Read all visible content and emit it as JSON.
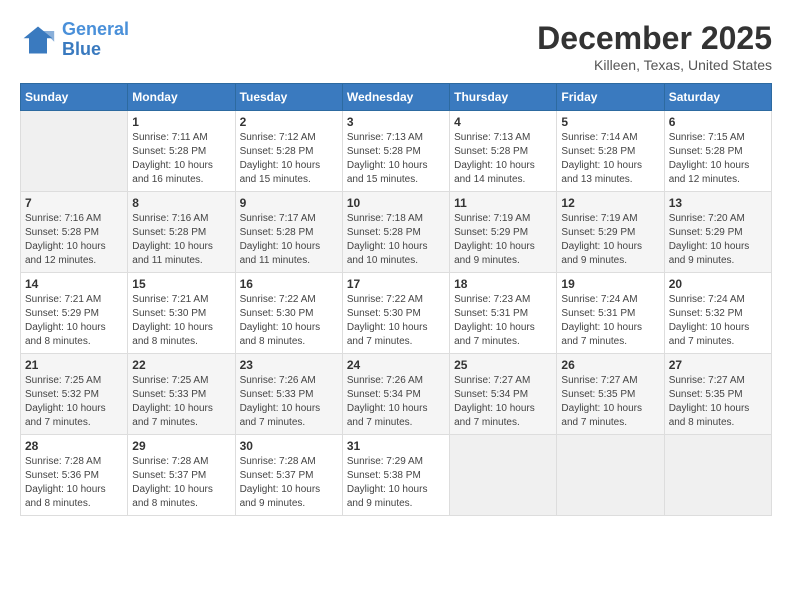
{
  "header": {
    "logo_line1": "General",
    "logo_line2": "Blue",
    "month": "December 2025",
    "location": "Killeen, Texas, United States"
  },
  "days_of_week": [
    "Sunday",
    "Monday",
    "Tuesday",
    "Wednesday",
    "Thursday",
    "Friday",
    "Saturday"
  ],
  "weeks": [
    [
      {
        "day": "",
        "info": ""
      },
      {
        "day": "1",
        "info": "Sunrise: 7:11 AM\nSunset: 5:28 PM\nDaylight: 10 hours\nand 16 minutes."
      },
      {
        "day": "2",
        "info": "Sunrise: 7:12 AM\nSunset: 5:28 PM\nDaylight: 10 hours\nand 15 minutes."
      },
      {
        "day": "3",
        "info": "Sunrise: 7:13 AM\nSunset: 5:28 PM\nDaylight: 10 hours\nand 15 minutes."
      },
      {
        "day": "4",
        "info": "Sunrise: 7:13 AM\nSunset: 5:28 PM\nDaylight: 10 hours\nand 14 minutes."
      },
      {
        "day": "5",
        "info": "Sunrise: 7:14 AM\nSunset: 5:28 PM\nDaylight: 10 hours\nand 13 minutes."
      },
      {
        "day": "6",
        "info": "Sunrise: 7:15 AM\nSunset: 5:28 PM\nDaylight: 10 hours\nand 12 minutes."
      }
    ],
    [
      {
        "day": "7",
        "info": "Sunrise: 7:16 AM\nSunset: 5:28 PM\nDaylight: 10 hours\nand 12 minutes."
      },
      {
        "day": "8",
        "info": "Sunrise: 7:16 AM\nSunset: 5:28 PM\nDaylight: 10 hours\nand 11 minutes."
      },
      {
        "day": "9",
        "info": "Sunrise: 7:17 AM\nSunset: 5:28 PM\nDaylight: 10 hours\nand 11 minutes."
      },
      {
        "day": "10",
        "info": "Sunrise: 7:18 AM\nSunset: 5:28 PM\nDaylight: 10 hours\nand 10 minutes."
      },
      {
        "day": "11",
        "info": "Sunrise: 7:19 AM\nSunset: 5:29 PM\nDaylight: 10 hours\nand 9 minutes."
      },
      {
        "day": "12",
        "info": "Sunrise: 7:19 AM\nSunset: 5:29 PM\nDaylight: 10 hours\nand 9 minutes."
      },
      {
        "day": "13",
        "info": "Sunrise: 7:20 AM\nSunset: 5:29 PM\nDaylight: 10 hours\nand 9 minutes."
      }
    ],
    [
      {
        "day": "14",
        "info": "Sunrise: 7:21 AM\nSunset: 5:29 PM\nDaylight: 10 hours\nand 8 minutes."
      },
      {
        "day": "15",
        "info": "Sunrise: 7:21 AM\nSunset: 5:30 PM\nDaylight: 10 hours\nand 8 minutes."
      },
      {
        "day": "16",
        "info": "Sunrise: 7:22 AM\nSunset: 5:30 PM\nDaylight: 10 hours\nand 8 minutes."
      },
      {
        "day": "17",
        "info": "Sunrise: 7:22 AM\nSunset: 5:30 PM\nDaylight: 10 hours\nand 7 minutes."
      },
      {
        "day": "18",
        "info": "Sunrise: 7:23 AM\nSunset: 5:31 PM\nDaylight: 10 hours\nand 7 minutes."
      },
      {
        "day": "19",
        "info": "Sunrise: 7:24 AM\nSunset: 5:31 PM\nDaylight: 10 hours\nand 7 minutes."
      },
      {
        "day": "20",
        "info": "Sunrise: 7:24 AM\nSunset: 5:32 PM\nDaylight: 10 hours\nand 7 minutes."
      }
    ],
    [
      {
        "day": "21",
        "info": "Sunrise: 7:25 AM\nSunset: 5:32 PM\nDaylight: 10 hours\nand 7 minutes."
      },
      {
        "day": "22",
        "info": "Sunrise: 7:25 AM\nSunset: 5:33 PM\nDaylight: 10 hours\nand 7 minutes."
      },
      {
        "day": "23",
        "info": "Sunrise: 7:26 AM\nSunset: 5:33 PM\nDaylight: 10 hours\nand 7 minutes."
      },
      {
        "day": "24",
        "info": "Sunrise: 7:26 AM\nSunset: 5:34 PM\nDaylight: 10 hours\nand 7 minutes."
      },
      {
        "day": "25",
        "info": "Sunrise: 7:27 AM\nSunset: 5:34 PM\nDaylight: 10 hours\nand 7 minutes."
      },
      {
        "day": "26",
        "info": "Sunrise: 7:27 AM\nSunset: 5:35 PM\nDaylight: 10 hours\nand 7 minutes."
      },
      {
        "day": "27",
        "info": "Sunrise: 7:27 AM\nSunset: 5:35 PM\nDaylight: 10 hours\nand 8 minutes."
      }
    ],
    [
      {
        "day": "28",
        "info": "Sunrise: 7:28 AM\nSunset: 5:36 PM\nDaylight: 10 hours\nand 8 minutes."
      },
      {
        "day": "29",
        "info": "Sunrise: 7:28 AM\nSunset: 5:37 PM\nDaylight: 10 hours\nand 8 minutes."
      },
      {
        "day": "30",
        "info": "Sunrise: 7:28 AM\nSunset: 5:37 PM\nDaylight: 10 hours\nand 9 minutes."
      },
      {
        "day": "31",
        "info": "Sunrise: 7:29 AM\nSunset: 5:38 PM\nDaylight: 10 hours\nand 9 minutes."
      },
      {
        "day": "",
        "info": ""
      },
      {
        "day": "",
        "info": ""
      },
      {
        "day": "",
        "info": ""
      }
    ]
  ]
}
